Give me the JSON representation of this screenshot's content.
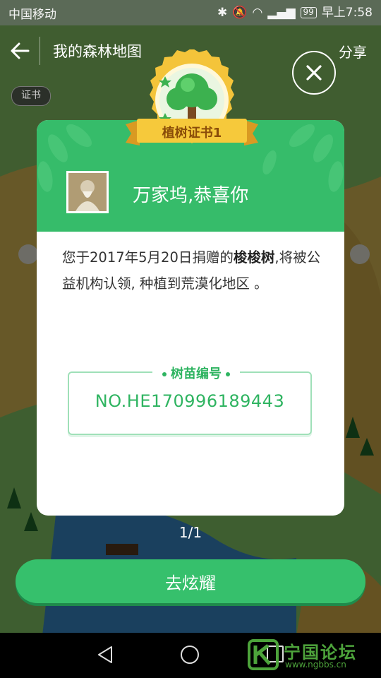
{
  "status_bar": {
    "carrier": "中国移动",
    "battery": "99",
    "time": "早上7:58"
  },
  "nav": {
    "title": "我的森林地图",
    "share": "分享"
  },
  "background": {
    "certificate_chip": "证书"
  },
  "badge": {
    "title": "植树证书1"
  },
  "card": {
    "greeting": "万家坞,恭喜你",
    "message_prefix": "您于2017年5月20日捐赠的",
    "tree_name": "梭梭树",
    "message_suffix": ",将被公益机构认领, 种植到荒漠化地区 。",
    "seed_label": "树苗编号",
    "seed_number": "NO.HE170996189443"
  },
  "pager": "1/1",
  "cta_label": "去炫耀",
  "watermark": {
    "text": "宁国论坛",
    "url": "www.ngbbs.cn"
  },
  "colors": {
    "primary_green": "#36bc6a",
    "badge_gold": "#f4c43a"
  }
}
